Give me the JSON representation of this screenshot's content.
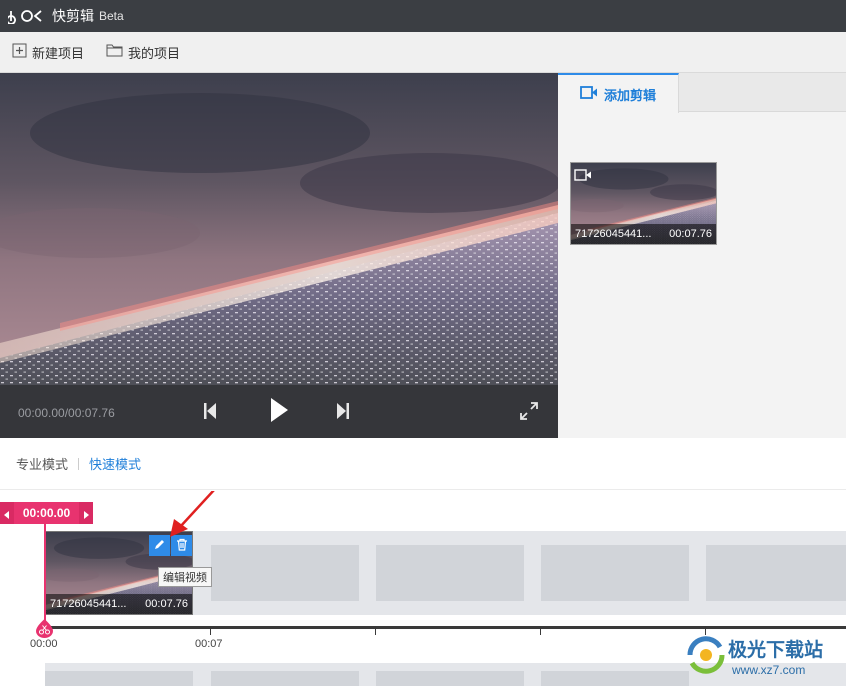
{
  "app": {
    "title": "快剪辑",
    "beta": "Beta"
  },
  "toolbar": {
    "new_project": "新建项目",
    "my_projects": "我的项目"
  },
  "player": {
    "timecode": "00:00.00/00:07.76"
  },
  "panel": {
    "tab_label": "添加剪辑",
    "media": {
      "name": "71726045441...",
      "duration": "00:07.76"
    }
  },
  "modes": {
    "pro": "专业模式",
    "quick": "快速模式"
  },
  "timeline": {
    "playhead_time": "00:00.00",
    "clip": {
      "name": "71726045441...",
      "duration": "00:07.76"
    },
    "tooltip": "编辑视频",
    "ticks": [
      "00:00",
      "00:07"
    ]
  },
  "watermark": {
    "text": "极光下载站",
    "url": "www.xz7.com"
  },
  "colors": {
    "accent": "#2e8be8",
    "playhead": "#e8336f",
    "titlebar": "#3b3e43"
  }
}
